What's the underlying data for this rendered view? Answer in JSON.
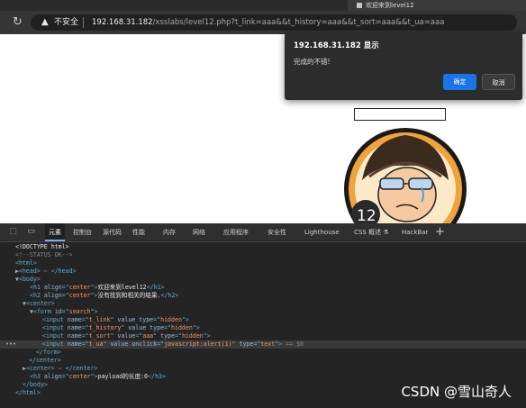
{
  "tab": {
    "title": "欢迎来到level12"
  },
  "address": {
    "security_label": "不安全",
    "url_host": "192.168.31.182",
    "url_rest": "/xsslabs/level12.php?t_link=aaa&&t_history=aaa&&t_sort=aaa&&t_ua=aaa"
  },
  "dialog": {
    "title": "192.168.31.182 显示",
    "message": "完成的不错!",
    "ok_label": "确定",
    "cancel_label": "取消"
  },
  "devtools": {
    "tabs": [
      "元素",
      "控制台",
      "源代码",
      "性能",
      "内存",
      "网络",
      "应用程序",
      "安全性",
      "Lighthouse",
      "CSS 概述 ⚗",
      "HackBar"
    ],
    "lines": {
      "l1": "<!DOCTYPE html>",
      "l2": "<!--STATUS OK-->",
      "l3": "<html>",
      "l4a": "▶",
      "l4b": "<head>",
      "l4c": " ⋯ ",
      "l4d": "</head>",
      "l5a": "▼",
      "l5b": "<body>",
      "l6a": "<h1 ",
      "l6b": "align",
      "l6c": "=\"",
      "l6d": "center",
      "l6e": "\">",
      "l6f": "欢迎来到level12",
      "l6g": "</h1>",
      "l7a": "<h2 ",
      "l7b": "align",
      "l7c": "=\"",
      "l7d": "center",
      "l7e": "\">",
      "l7f": "没有找到和相关的结果.",
      "l7g": "</h2>",
      "l8a": "▼",
      "l8b": "<center>",
      "l9a": "▼",
      "l9b": "<form ",
      "l9c": "id",
      "l9d": "=\"",
      "l9e": "search",
      "l9f": "\">",
      "l10a": "<input ",
      "l10b": "name",
      "l10c": "=\"",
      "l10d": "t_link",
      "l10e": "\" ",
      "l10f": "value",
      "l10g": " ",
      "l10h": "type",
      "l10i": "=\"",
      "l10j": "hidden",
      "l10k": "\">",
      "l11a": "<input ",
      "l11b": "name",
      "l11c": "=\"",
      "l11d": "t_history",
      "l11e": "\" ",
      "l11f": "value",
      "l11g": " ",
      "l11h": "type",
      "l11i": "=\"",
      "l11j": "hidden",
      "l11k": "\">",
      "l12a": "<input ",
      "l12b": "name",
      "l12c": "=\"",
      "l12d": "t_sort",
      "l12e": "\" ",
      "l12f": "value",
      "l12g": "=\"",
      "l12h": "aaa",
      "l12i": "\" ",
      "l12j": "type",
      "l12k": "=\"",
      "l12l": "hidden",
      "l12m": "\">",
      "l13a": "<input ",
      "l13b": "name",
      "l13c": "=\"",
      "l13d": "t_ua",
      "l13e": "\" ",
      "l13f": "value",
      "l13g": " ",
      "l13h": "onclick",
      "l13i": "=\"",
      "l13j": "javascript:alert(1)",
      "l13k": "\" ",
      "l13l": "type",
      "l13m": "=\"",
      "l13n": "text",
      "l13o": "\"> ",
      "l13p": "== $0",
      "l14": "</form>",
      "l15": "</center>",
      "l16a": "▶",
      "l16b": "<center>",
      "l16c": " ⋯ ",
      "l16d": "</center>",
      "l17a": "<h3 ",
      "l17b": "align",
      "l17c": "=\"",
      "l17d": "center",
      "l17e": "\">",
      "l17f": "payload的长度:0",
      "l17g": "</h3>",
      "l18": "</body>",
      "l19": "</html>"
    }
  },
  "watermark": "CSDN @雪山奇人"
}
